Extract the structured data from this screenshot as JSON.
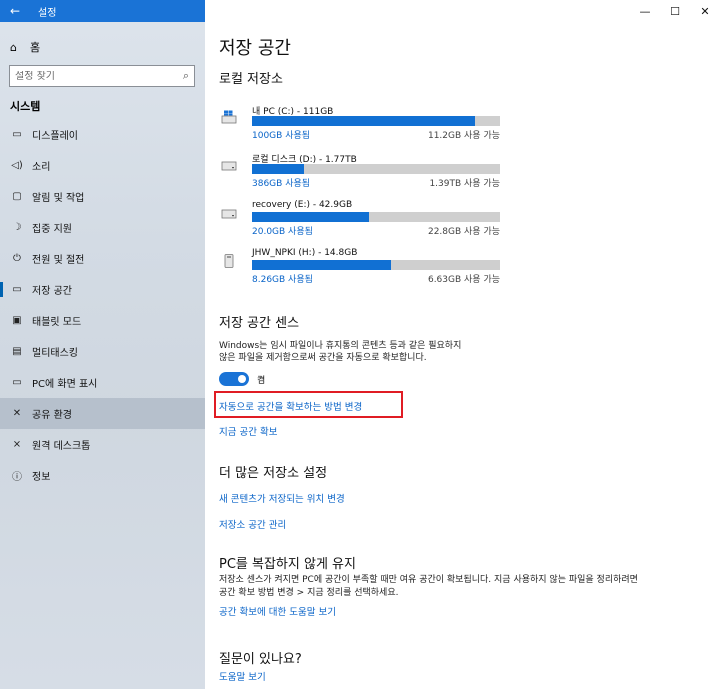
{
  "titlebar": {
    "back_icon": "back-arrow-icon",
    "title": "설정"
  },
  "window_controls": {
    "minimize": "—",
    "maximize": "☐",
    "close": "✕"
  },
  "sidebar": {
    "home_label": "홈",
    "search_placeholder": "설정 찾기",
    "section": "시스템",
    "items": [
      {
        "label": "디스플레이",
        "icon": "display-icon",
        "glyph": "▭"
      },
      {
        "label": "소리",
        "icon": "sound-icon",
        "glyph": "🔈"
      },
      {
        "label": "알림 및 작업",
        "icon": "notifications-icon",
        "glyph": "▢"
      },
      {
        "label": "집중 지원",
        "icon": "focus-assist-icon",
        "glyph": "☽"
      },
      {
        "label": "전원 및 절전",
        "icon": "power-icon",
        "glyph": "⏻"
      },
      {
        "label": "저장 공간",
        "icon": "storage-icon",
        "glyph": "▭"
      },
      {
        "label": "태블릿 모드",
        "icon": "tablet-icon",
        "glyph": "▣"
      },
      {
        "label": "멀티태스킹",
        "icon": "multitasking-icon",
        "glyph": "▤"
      },
      {
        "label": "PC에 화면 표시",
        "icon": "project-icon",
        "glyph": "▭"
      },
      {
        "label": "공유 환경",
        "icon": "shared-experiences-icon",
        "glyph": "✕"
      },
      {
        "label": "원격 데스크톱",
        "icon": "remote-desktop-icon",
        "glyph": "✕"
      },
      {
        "label": "정보",
        "icon": "info-icon",
        "glyph": "ⓘ"
      }
    ]
  },
  "main": {
    "title": "저장 공간",
    "local_storage_heading": "로컬 저장소",
    "drives": [
      {
        "name": "내 PC (C:) - 111GB",
        "used": "100GB 사용됨",
        "free": "11.2GB 사용 가능",
        "used_fraction": 0.9,
        "icon": "windows-drive-icon"
      },
      {
        "name": "로컬 디스크 (D:) - 1.77TB",
        "used": "386GB 사용됨",
        "free": "1.39TB 사용 가능",
        "used_fraction": 0.21,
        "icon": "hard-drive-icon"
      },
      {
        "name": "recovery (E:) - 42.9GB",
        "used": "20.0GB 사용됨",
        "free": "22.8GB 사용 가능",
        "used_fraction": 0.47,
        "icon": "hard-drive-icon"
      },
      {
        "name": "JHW_NPKI (H:) - 14.8GB",
        "used": "8.26GB 사용됨",
        "free": "6.63GB 사용 가능",
        "used_fraction": 0.56,
        "icon": "usb-drive-icon"
      }
    ],
    "sense_heading": "저장 공간 센스",
    "sense_desc_line1": "Windows는 임시 파일이나 휴지통의 콘텐츠 등과 같은 필요하지",
    "sense_desc_line2": "않은 파일을 제거함으로써 공간을 자동으로 확보합니다.",
    "toggle_label": "켬",
    "change_auto_link": "자동으로 공간을 확보하는 방법 변경",
    "free_now_link": "지금 공간 확보",
    "more_heading": "더 많은 저장소 설정",
    "change_location_link": "새 콘텐츠가 저장되는 위치 변경",
    "manage_spaces_link": "저장소 공간 관리",
    "declutter_heading": "PC를 복잡하지 않게 유지",
    "declutter_line1": "저장소 센스가 켜지면 PC에 공간이 부족할 때만 여유 공간이 확보됩니다. 지금 사용하지 않는 파일을 정리하려면",
    "declutter_line2": "공간 확보 방법 변경 > 지금 정리를 선택하세요.",
    "help_free_link": "공간 확보에 대한 도움말 보기",
    "question_heading": "질문이 있나요?",
    "get_help_link": "도움말 보기"
  }
}
